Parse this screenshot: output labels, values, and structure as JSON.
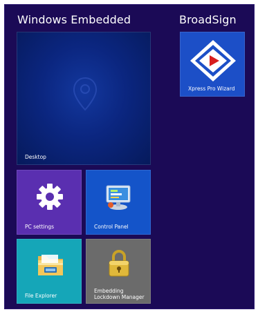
{
  "groups": [
    {
      "title": "Windows Embedded"
    },
    {
      "title": "BroadSign"
    }
  ],
  "tiles": {
    "desktop": {
      "label": "Desktop",
      "color": "#0a2a8a"
    },
    "pc_settings": {
      "label": "PC settings",
      "color": "#5a2fb0",
      "icon": "gear-icon"
    },
    "control_panel": {
      "label": "Control Panel",
      "color": "#1454c9",
      "icon": "control-panel-icon"
    },
    "file_explorer": {
      "label": "File Explorer",
      "color": "#15a6b8",
      "icon": "folder-icon"
    },
    "lockdown_manager": {
      "label": "Embedding Lockdown Manager",
      "color": "#6b6b6b",
      "icon": "padlock-icon"
    },
    "xpress_pro": {
      "label": "Xpress Pro Wizard",
      "color": "#1c4fc7",
      "icon": "play-logo-icon"
    }
  },
  "colors": {
    "background": "#1b0a56",
    "accent": "#d81e1e"
  }
}
